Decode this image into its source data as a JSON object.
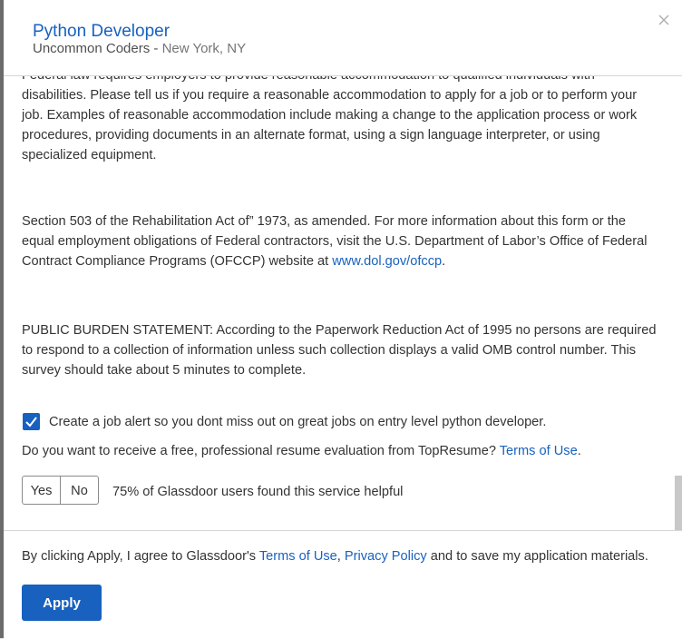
{
  "header": {
    "job_title": "Python Developer",
    "company": "Uncommon Coders",
    "separator": " - ",
    "location": "New York, NY",
    "close_icon": "close-icon"
  },
  "body": {
    "paragraph1": "Federal law requires employers to provide reasonable accommodation to qualified individuals with disabilities. Please tell us if you require a reasonable accommodation to apply for a job or to perform your job. Examples of reasonable accommodation include making a change to the application process or work procedures, providing documents in an alternate format, using a sign language interpreter, or using specialized equipment.",
    "paragraph2_text": "Section 503 of the Rehabilitation Act of” 1973, as amended. For more information about this form or the equal employment obligations of Federal contractors, visit the U.S. Department of Labor’s Office of Federal Contract Compliance Programs (OFCCP) website at ",
    "paragraph2_link": "www.dol.gov/ofccp",
    "paragraph2_end": ".",
    "paragraph3": "PUBLIC BURDEN STATEMENT: According to the Paperwork Reduction Act of 1995 no persons are required to respond to a collection of information unless such collection displays a valid OMB control number. This survey should take about 5 minutes to complete.",
    "job_alert": {
      "checked": true,
      "label": "Create a job alert so you dont miss out on great jobs on entry level python developer."
    },
    "resume_question": "Do you want to receive a free, professional resume evaluation from TopResume? ",
    "resume_terms_link": "Terms of Use",
    "resume_question_end": ".",
    "yes_label": "Yes",
    "no_label": "No",
    "helpful_text": "75% of Glassdoor users found this service helpful"
  },
  "footer": {
    "consent_prefix": "By clicking Apply, I agree to Glassdoor's ",
    "terms_link": "Terms of Use",
    "comma": ", ",
    "privacy_link": "Privacy Policy",
    "consent_suffix": " and to save my application materials.",
    "apply_label": "Apply"
  },
  "colors": {
    "accent": "#1861bf",
    "text": "#333333"
  }
}
